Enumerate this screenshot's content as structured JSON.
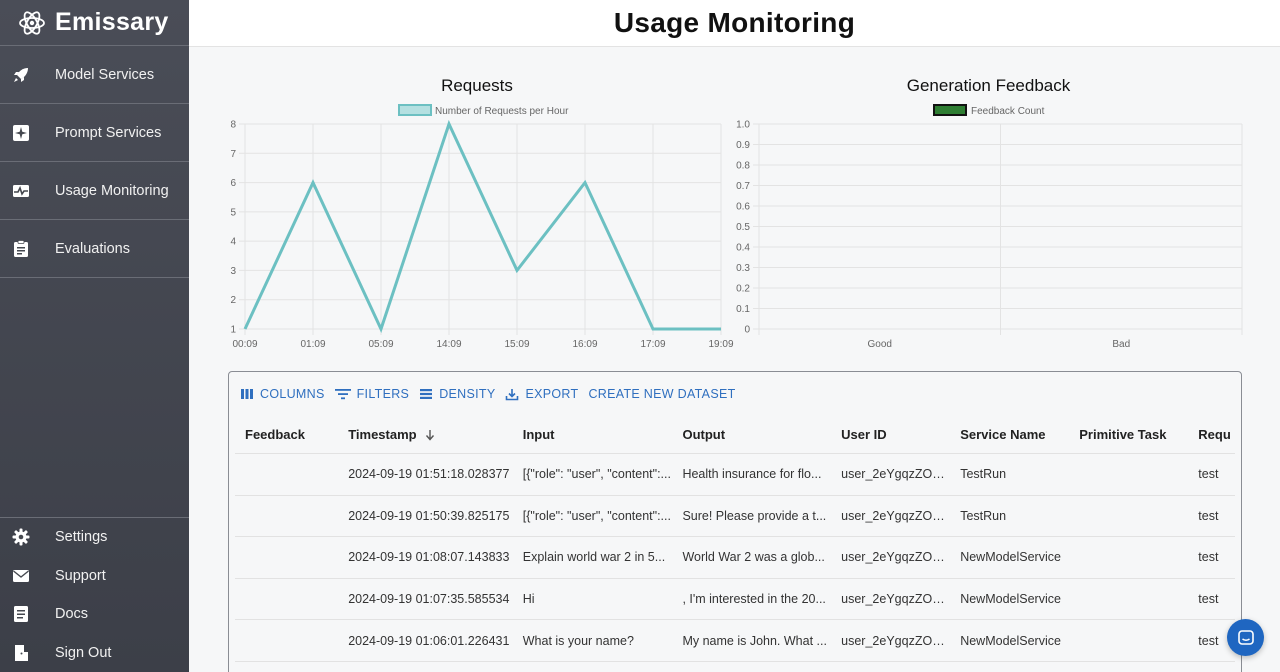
{
  "app": {
    "brand": "Emissary",
    "page_title": "Usage Monitoring"
  },
  "sidebar": {
    "items": [
      {
        "label": "Model Services",
        "icon": "rocket-icon"
      },
      {
        "label": "Prompt Services",
        "icon": "sparkle-box-icon"
      },
      {
        "label": "Usage Monitoring",
        "icon": "pulse-icon"
      },
      {
        "label": "Evaluations",
        "icon": "clipboard-icon"
      }
    ],
    "bottom_items": [
      {
        "label": "Settings",
        "icon": "gear-icon"
      },
      {
        "label": "Support",
        "icon": "envelope-icon"
      },
      {
        "label": "Docs",
        "icon": "document-icon"
      },
      {
        "label": "Sign Out",
        "icon": "door-exit-icon"
      }
    ]
  },
  "chart_data": [
    {
      "type": "line",
      "title": "Requests",
      "x": [
        "00:09",
        "01:09",
        "05:09",
        "14:09",
        "15:09",
        "16:09",
        "17:09",
        "19:09"
      ],
      "series": [
        {
          "name": "Number of Requests per Hour",
          "values": [
            1,
            6,
            1,
            8,
            3,
            6,
            1,
            1
          ],
          "color": "#6cc0c2"
        }
      ],
      "ylim": [
        1,
        8
      ],
      "yticks": [
        "1",
        "2",
        "3",
        "4",
        "5",
        "6",
        "7",
        "8"
      ],
      "grid": true,
      "legend": "top"
    },
    {
      "type": "bar",
      "title": "Generation Feedback",
      "categories": [
        "Good",
        "Bad"
      ],
      "series": [
        {
          "name": "Feedback Count",
          "values": [
            0,
            0
          ],
          "color": "#2e7d32"
        }
      ],
      "ylim": [
        0,
        1
      ],
      "yticks": [
        "0",
        "0.1",
        "0.2",
        "0.3",
        "0.4",
        "0.5",
        "0.6",
        "0.7",
        "0.8",
        "0.9",
        "1.0"
      ],
      "grid": true,
      "legend": "top"
    }
  ],
  "table": {
    "toolbar": {
      "columns": "COLUMNS",
      "filters": "FILTERS",
      "density": "DENSITY",
      "export": "EXPORT",
      "create_dataset": "CREATE NEW DATASET"
    },
    "headers": [
      "Feedback",
      "Timestamp",
      "Input",
      "Output",
      "User ID",
      "Service Name",
      "Primitive Task",
      "Requ"
    ],
    "rows": [
      [
        "",
        "2024-09-19 01:51:18.028377",
        "[{\"role\": \"user\", \"content\":...",
        "Health insurance for flo...",
        "user_2eYgqzZOU...",
        "TestRun",
        "",
        "test"
      ],
      [
        "",
        "2024-09-19 01:50:39.825175",
        "[{\"role\": \"user\", \"content\":...",
        "Sure! Please provide a t...",
        "user_2eYgqzZOU...",
        "TestRun",
        "",
        "test"
      ],
      [
        "",
        "2024-09-19 01:08:07.143833",
        "Explain world war 2 in 5...",
        "World War 2 was a glob...",
        "user_2eYgqzZOU...",
        "NewModelService",
        "",
        "test"
      ],
      [
        "",
        "2024-09-19 01:07:35.585534",
        "Hi",
        ", I'm interested in the 20...",
        "user_2eYgqzZOU...",
        "NewModelService",
        "",
        "test"
      ],
      [
        "",
        "2024-09-19 01:06:01.226431",
        "What is your name?",
        "My name is John. What ...",
        "user_2eYgqzZOU...",
        "NewModelService",
        "",
        "test"
      ]
    ]
  },
  "colors": {
    "accent": "#2f6fbf",
    "sidebar": "#45484f",
    "line": "#6cc0c2",
    "feedback": "#2e7d32"
  }
}
